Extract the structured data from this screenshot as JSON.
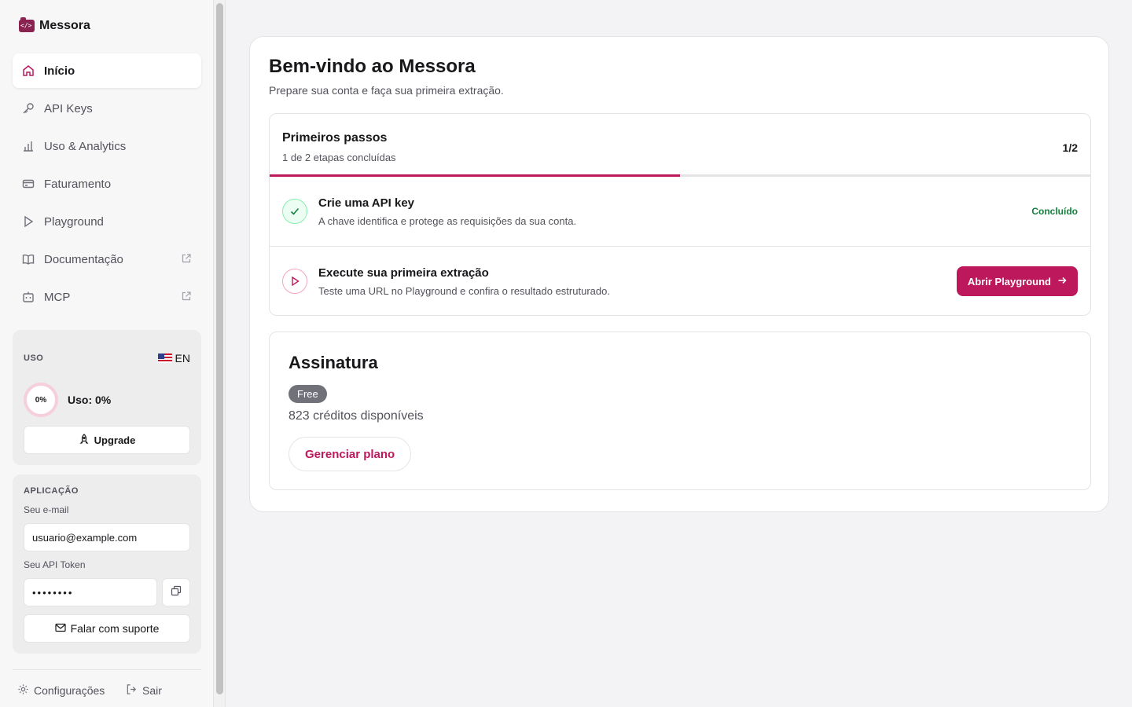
{
  "app": {
    "name": "Messora",
    "logo_glyph": "</>"
  },
  "sidebar": {
    "items": [
      {
        "label": "Início",
        "icon": "home-icon",
        "active": true
      },
      {
        "label": "API Keys",
        "icon": "key-icon"
      },
      {
        "label": "Uso & Analytics",
        "icon": "bar-chart-icon"
      },
      {
        "label": "Faturamento",
        "icon": "credit-card-icon"
      },
      {
        "label": "Playground",
        "icon": "play-icon"
      },
      {
        "label": "Documentação",
        "icon": "book-icon",
        "external": true
      },
      {
        "label": "MCP",
        "icon": "bot-icon",
        "external": true
      }
    ],
    "usage": {
      "label": "USO",
      "language": "EN",
      "percent_text": "0%",
      "usage_text": "Uso: 0%",
      "usage_fraction": 0,
      "upgrade_label": "Upgrade"
    },
    "application": {
      "label": "APLICAÇÃO",
      "email_label": "Seu e-mail",
      "email_value": "usuario@example.com",
      "token_label": "Seu API Token",
      "token_value": "••••••••",
      "support_label": "Falar com suporte"
    },
    "footer": {
      "settings_label": "Configurações",
      "logout_label": "Sair"
    }
  },
  "main": {
    "title": "Bem-vindo ao Messora",
    "subtitle": "Prepare sua conta e faça sua primeira extração.",
    "steps": {
      "title": "Primeiros passos",
      "subtitle": "1 de 2 etapas concluídas",
      "count": "1/2",
      "progress_fraction": 0.5,
      "items": [
        {
          "title": "Crie uma API key",
          "description": "A chave identifica e protege as requisições da sua conta.",
          "status": "Concluído"
        },
        {
          "title": "Execute sua primeira extração",
          "description": "Teste uma URL no Playground e confira o resultado estruturado.",
          "action_label": "Abrir Playground"
        }
      ]
    },
    "subscription": {
      "title": "Assinatura",
      "plan": "Free",
      "credits": "823 créditos disponíveis",
      "manage_label": "Gerenciar plano"
    }
  },
  "colors": {
    "accent": "#be185d",
    "success": "#15803d"
  }
}
